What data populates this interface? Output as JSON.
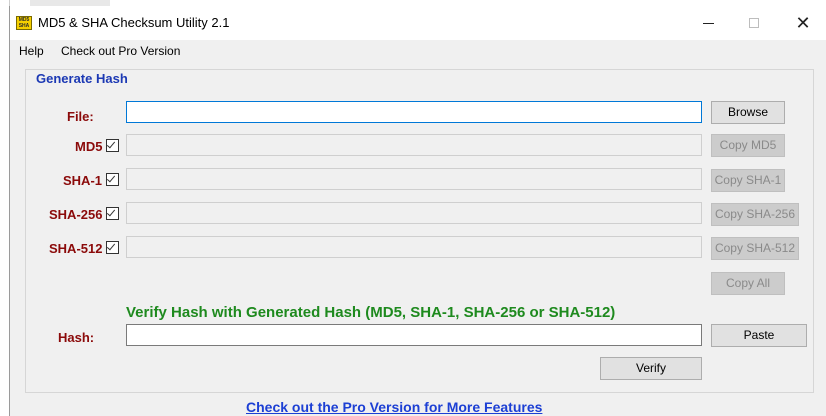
{
  "window": {
    "title": "MD5 & SHA Checksum Utility 2.1",
    "icon_text": "MD5 SHA",
    "controls": {
      "minimize": "—",
      "maximize": "☐",
      "close": "✕"
    }
  },
  "menu": {
    "help": "Help",
    "pro": "Check out Pro Version"
  },
  "generate": {
    "group_title": "Generate Hash",
    "file_label": "File:",
    "file_value": "",
    "browse_label": "Browse",
    "rows": [
      {
        "label": "MD5",
        "checked": true,
        "value": "",
        "copy_label": "Copy MD5"
      },
      {
        "label": "SHA-1",
        "checked": true,
        "value": "",
        "copy_label": "Copy SHA-1"
      },
      {
        "label": "SHA-256",
        "checked": true,
        "value": "",
        "copy_label": "Copy SHA-256"
      },
      {
        "label": "SHA-512",
        "checked": true,
        "value": "",
        "copy_label": "Copy SHA-512"
      }
    ],
    "copy_all_label": "Copy All"
  },
  "verify": {
    "title": "Verify Hash with Generated Hash (MD5, SHA-1, SHA-256 or SHA-512)",
    "hash_label": "Hash:",
    "hash_value": "",
    "paste_label": "Paste",
    "verify_label": "Verify"
  },
  "footer": {
    "pro_link": "Check out the Pro Version for More Features"
  },
  "colors": {
    "accent_blue": "#1c39b4",
    "label_red": "#8b0a0a",
    "verify_green": "#1e8a1e",
    "link_blue": "#1c3fd4",
    "focus_border": "#0078d7"
  }
}
